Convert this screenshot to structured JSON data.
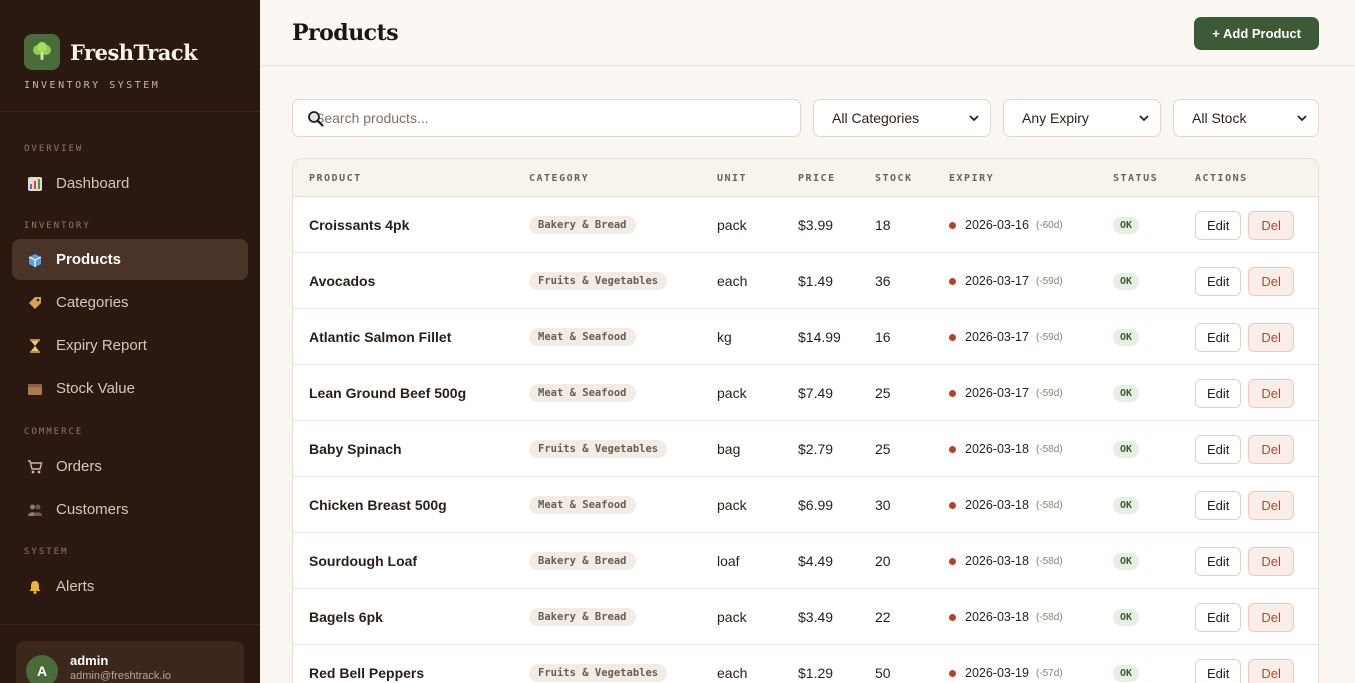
{
  "brand": {
    "name": "FreshTrack",
    "subtitle": "INVENTORY SYSTEM"
  },
  "nav": {
    "sections": [
      {
        "label": "OVERVIEW",
        "items": [
          {
            "label": "Dashboard",
            "icon": "chart-icon"
          }
        ]
      },
      {
        "label": "INVENTORY",
        "items": [
          {
            "label": "Products",
            "icon": "box-icon",
            "active": true
          },
          {
            "label": "Categories",
            "icon": "tag-icon"
          },
          {
            "label": "Expiry Report",
            "icon": "hourglass-icon"
          },
          {
            "label": "Stock Value",
            "icon": "package-icon"
          }
        ]
      },
      {
        "label": "COMMERCE",
        "items": [
          {
            "label": "Orders",
            "icon": "cart-icon"
          },
          {
            "label": "Customers",
            "icon": "users-icon"
          }
        ]
      },
      {
        "label": "SYSTEM",
        "items": [
          {
            "label": "Alerts",
            "icon": "bell-icon"
          }
        ]
      }
    ]
  },
  "user": {
    "initial": "A",
    "name": "admin",
    "email": "admin@freshtrack.io"
  },
  "header": {
    "title": "Products",
    "add_label": "+ Add Product"
  },
  "filters": {
    "search_placeholder": "Search products...",
    "category": "All Categories",
    "expiry": "Any Expiry",
    "stock": "All Stock"
  },
  "table": {
    "columns": [
      "PRODUCT",
      "CATEGORY",
      "UNIT",
      "PRICE",
      "STOCK",
      "EXPIRY",
      "STATUS",
      "ACTIONS"
    ],
    "edit_label": "Edit",
    "del_label": "Del",
    "rows": [
      {
        "product": "Croissants 4pk",
        "category": "Bakery & Bread",
        "unit": "pack",
        "price": "$3.99",
        "stock": "18",
        "expiry": "2026-03-16",
        "days": "(-60d)",
        "status": "OK"
      },
      {
        "product": "Avocados",
        "category": "Fruits & Vegetables",
        "unit": "each",
        "price": "$1.49",
        "stock": "36",
        "expiry": "2026-03-17",
        "days": "(-59d)",
        "status": "OK"
      },
      {
        "product": "Atlantic Salmon Fillet",
        "category": "Meat & Seafood",
        "unit": "kg",
        "price": "$14.99",
        "stock": "16",
        "expiry": "2026-03-17",
        "days": "(-59d)",
        "status": "OK"
      },
      {
        "product": "Lean Ground Beef 500g",
        "category": "Meat & Seafood",
        "unit": "pack",
        "price": "$7.49",
        "stock": "25",
        "expiry": "2026-03-17",
        "days": "(-59d)",
        "status": "OK"
      },
      {
        "product": "Baby Spinach",
        "category": "Fruits & Vegetables",
        "unit": "bag",
        "price": "$2.79",
        "stock": "25",
        "expiry": "2026-03-18",
        "days": "(-58d)",
        "status": "OK"
      },
      {
        "product": "Chicken Breast 500g",
        "category": "Meat & Seafood",
        "unit": "pack",
        "price": "$6.99",
        "stock": "30",
        "expiry": "2026-03-18",
        "days": "(-58d)",
        "status": "OK"
      },
      {
        "product": "Sourdough Loaf",
        "category": "Bakery & Bread",
        "unit": "loaf",
        "price": "$4.49",
        "stock": "20",
        "expiry": "2026-03-18",
        "days": "(-58d)",
        "status": "OK"
      },
      {
        "product": "Bagels 6pk",
        "category": "Bakery & Bread",
        "unit": "pack",
        "price": "$3.49",
        "stock": "22",
        "expiry": "2026-03-18",
        "days": "(-58d)",
        "status": "OK"
      },
      {
        "product": "Red Bell Peppers",
        "category": "Fruits & Vegetables",
        "unit": "each",
        "price": "$1.29",
        "stock": "50",
        "expiry": "2026-03-19",
        "days": "(-57d)",
        "status": "OK"
      }
    ]
  },
  "colors": {
    "sidebar": "#2b1810",
    "accent": "#3d5a36",
    "danger": "#b5432a"
  }
}
